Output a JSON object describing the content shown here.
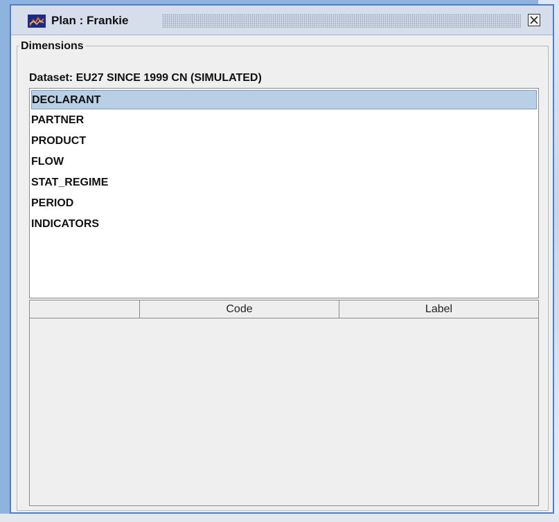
{
  "window": {
    "title": "Plan : Frankie",
    "accent": "#4f7fc3"
  },
  "dimensions": {
    "legend": "Dimensions",
    "dataset_label": "Dataset: EU27 SINCE 1999 CN (SIMULATED)",
    "items": [
      {
        "label": "DECLARANT",
        "selected": true
      },
      {
        "label": "PARTNER"
      },
      {
        "label": "PRODUCT"
      },
      {
        "label": "FLOW"
      },
      {
        "label": "STAT_REGIME"
      },
      {
        "label": "PERIOD"
      },
      {
        "label": "INDICATORS"
      }
    ]
  },
  "table": {
    "columns": [
      "",
      "Code",
      "Label"
    ]
  }
}
